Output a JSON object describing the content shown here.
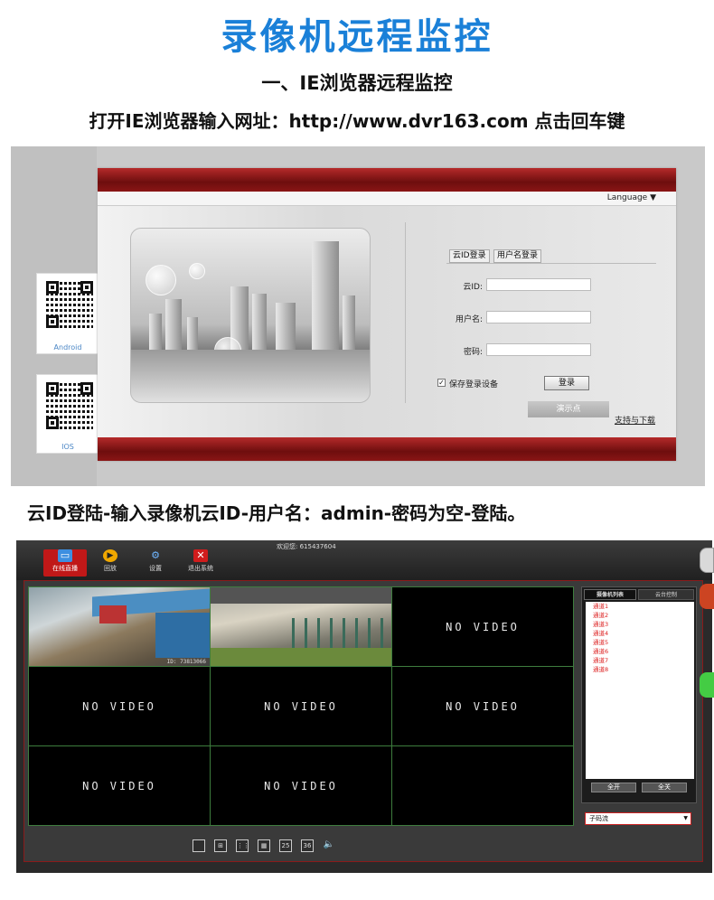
{
  "header": {
    "title": "录像机远程监控",
    "subtitle": "一、IE浏览器远程监控",
    "instruction_1": "打开IE浏览器输入网址：http://www.dvr163.com 点击回车键",
    "instruction_2": "云ID登陆-输入录像机云ID-用户名：admin-密码为空-登陆。"
  },
  "login": {
    "language": "Language ▼",
    "tabs": [
      "云ID登录",
      "用户名登录"
    ],
    "cloud_id_label": "云ID:",
    "username_label": "用户名:",
    "password_label": "密码:",
    "remember_label": "保存登录设备",
    "remember_checked": true,
    "login_button": "登录",
    "demo_button": "演示点",
    "support_link": "支持与下载",
    "qr_android_label": "Android",
    "qr_ios_label": "IOS"
  },
  "dvr": {
    "welcome": "欢迎您: 615437604",
    "toolbar": [
      "在线直播",
      "回放",
      "设置",
      "退出系统"
    ],
    "cam1_stamp": "ID: 73813066",
    "no_video": "NO VIDEO",
    "panel_tabs": [
      "摄像机列表",
      "云台控制"
    ],
    "channels": [
      "通道1",
      "通道2",
      "通道3",
      "通道4",
      "通道5",
      "通道6",
      "通道7",
      "通道8"
    ],
    "open_all": "全开",
    "close_all": "全关",
    "stream": "子码流",
    "layouts": [
      "25",
      "36"
    ]
  }
}
